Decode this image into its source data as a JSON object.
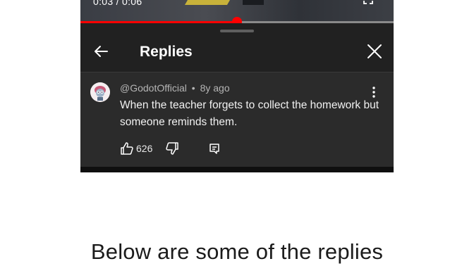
{
  "video": {
    "time": "0:03 / 0:06",
    "progress": 0.5,
    "colors": {
      "played": "#ff0000",
      "track": "#8a8a8a"
    }
  },
  "panel": {
    "title": "Replies",
    "back_icon": "arrow-left-icon",
    "close_icon": "close-icon"
  },
  "comment": {
    "author": "@GodotOfficial",
    "separator": "•",
    "age": "8y ago",
    "text": "When the teacher forgets to collect the homework but someone reminds them.",
    "likes": "626",
    "icons": [
      "thumbs-up-icon",
      "thumbs-down-icon",
      "reply-icon",
      "more-vertical-icon"
    ]
  },
  "caption": "Below are some of the replies"
}
